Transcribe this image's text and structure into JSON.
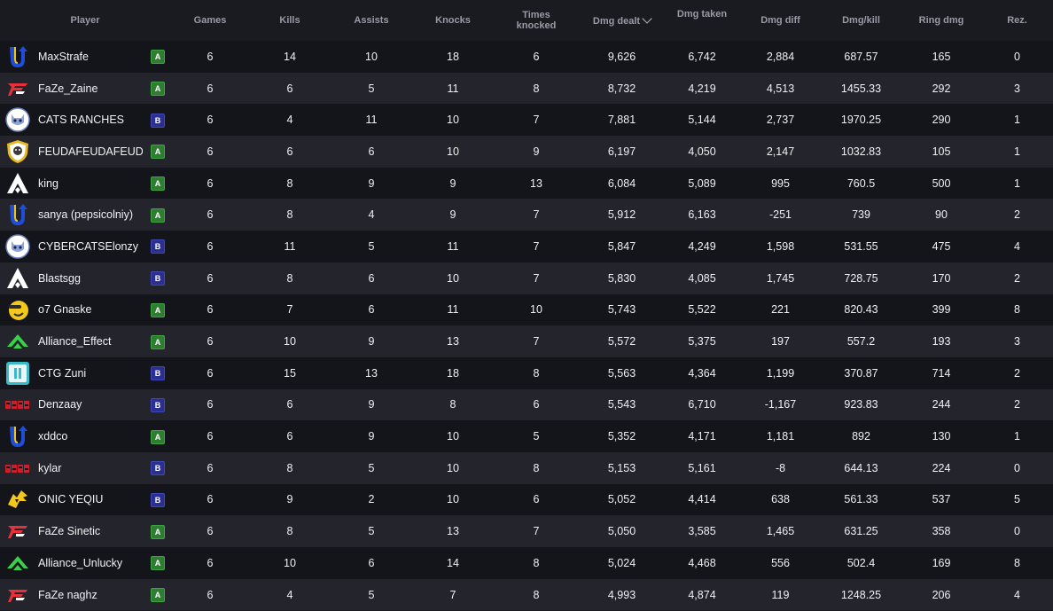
{
  "columns": [
    {
      "key": "player",
      "label": "Player"
    },
    {
      "key": "games",
      "label": "Games"
    },
    {
      "key": "kills",
      "label": "Kills"
    },
    {
      "key": "assists",
      "label": "Assists"
    },
    {
      "key": "knocks",
      "label": "Knocks"
    },
    {
      "key": "times_knocked",
      "label": "Times knocked"
    },
    {
      "key": "dmg_dealt",
      "label": "Dmg dealt",
      "sorted": "desc"
    },
    {
      "key": "dmg_taken",
      "label": "Dmg taken"
    },
    {
      "key": "dmg_diff",
      "label": "Dmg diff"
    },
    {
      "key": "dmg_kill",
      "label": "Dmg/kill"
    },
    {
      "key": "ring_dmg",
      "label": "Ring dmg"
    },
    {
      "key": "rez",
      "label": "Rez."
    }
  ],
  "colors": {
    "badge_a": "#2f7d32",
    "badge_b": "#2b2f8f",
    "row_dark": "#14141b",
    "row_light": "#24242c"
  },
  "rows": [
    {
      "logo": "u-team-logo",
      "player": "MaxStrafe",
      "group": "A",
      "games": "6",
      "kills": "14",
      "assists": "10",
      "knocks": "18",
      "times_knocked": "6",
      "dmg_dealt": "9,626",
      "dmg_taken": "6,742",
      "dmg_diff": "2,884",
      "dmg_kill": "687.57",
      "ring_dmg": "165",
      "rez": "0"
    },
    {
      "logo": "faze-logo",
      "player": "FaZe_Zaine",
      "group": "A",
      "games": "6",
      "kills": "6",
      "assists": "5",
      "knocks": "11",
      "times_knocked": "8",
      "dmg_dealt": "8,732",
      "dmg_taken": "4,219",
      "dmg_diff": "4,513",
      "dmg_kill": "1455.33",
      "ring_dmg": "292",
      "rez": "3"
    },
    {
      "logo": "cats-logo",
      "player": "CATS RANCHES",
      "group": "B",
      "games": "6",
      "kills": "4",
      "assists": "11",
      "knocks": "10",
      "times_knocked": "7",
      "dmg_dealt": "7,881",
      "dmg_taken": "5,144",
      "dmg_diff": "2,737",
      "dmg_kill": "1970.25",
      "ring_dmg": "290",
      "rez": "1"
    },
    {
      "logo": "shield-crest-logo",
      "player": "FEUDAFEUDAFEUDA",
      "group": "A",
      "games": "6",
      "kills": "6",
      "assists": "6",
      "knocks": "10",
      "times_knocked": "9",
      "dmg_dealt": "6,197",
      "dmg_taken": "4,050",
      "dmg_diff": "2,147",
      "dmg_kill": "1032.83",
      "ring_dmg": "105",
      "rez": "1"
    },
    {
      "logo": "apex-logo",
      "player": "king",
      "group": "A",
      "games": "6",
      "kills": "8",
      "assists": "9",
      "knocks": "9",
      "times_knocked": "13",
      "dmg_dealt": "6,084",
      "dmg_taken": "5,089",
      "dmg_diff": "995",
      "dmg_kill": "760.5",
      "ring_dmg": "500",
      "rez": "1"
    },
    {
      "logo": "u-team-logo",
      "player": "sanya (pepsicolniy)",
      "group": "A",
      "games": "6",
      "kills": "8",
      "assists": "4",
      "knocks": "9",
      "times_knocked": "7",
      "dmg_dealt": "5,912",
      "dmg_taken": "6,163",
      "dmg_diff": "-251",
      "dmg_kill": "739",
      "ring_dmg": "90",
      "rez": "2"
    },
    {
      "logo": "cats-logo",
      "player": "CYBERCATSElonzy",
      "group": "B",
      "games": "6",
      "kills": "11",
      "assists": "5",
      "knocks": "11",
      "times_knocked": "7",
      "dmg_dealt": "5,847",
      "dmg_taken": "4,249",
      "dmg_diff": "1,598",
      "dmg_kill": "531.55",
      "ring_dmg": "475",
      "rez": "4"
    },
    {
      "logo": "apex-logo",
      "player": "Blastsgg",
      "group": "B",
      "games": "6",
      "kills": "8",
      "assists": "6",
      "knocks": "10",
      "times_knocked": "7",
      "dmg_dealt": "5,830",
      "dmg_taken": "4,085",
      "dmg_diff": "1,745",
      "dmg_kill": "728.75",
      "ring_dmg": "170",
      "rez": "2"
    },
    {
      "logo": "smiley-logo",
      "player": "o7 Gnaske",
      "group": "A",
      "games": "6",
      "kills": "7",
      "assists": "6",
      "knocks": "11",
      "times_knocked": "10",
      "dmg_dealt": "5,743",
      "dmg_taken": "5,522",
      "dmg_diff": "221",
      "dmg_kill": "820.43",
      "ring_dmg": "399",
      "rez": "8"
    },
    {
      "logo": "alliance-logo",
      "player": "Alliance_Effect",
      "group": "A",
      "games": "6",
      "kills": "10",
      "assists": "9",
      "knocks": "13",
      "times_knocked": "7",
      "dmg_dealt": "5,572",
      "dmg_taken": "5,375",
      "dmg_diff": "197",
      "dmg_kill": "557.2",
      "ring_dmg": "193",
      "rez": "3"
    },
    {
      "logo": "ctg-logo",
      "player": "CTG Zuni",
      "group": "B",
      "games": "6",
      "kills": "15",
      "assists": "13",
      "knocks": "18",
      "times_knocked": "8",
      "dmg_dealt": "5,563",
      "dmg_taken": "4,364",
      "dmg_diff": "1,199",
      "dmg_kill": "370.87",
      "ring_dmg": "714",
      "rez": "2"
    },
    {
      "logo": "s2g-logo",
      "player": "Denzaay",
      "group": "B",
      "games": "6",
      "kills": "6",
      "assists": "9",
      "knocks": "8",
      "times_knocked": "6",
      "dmg_dealt": "5,543",
      "dmg_taken": "6,710",
      "dmg_diff": "-1,167",
      "dmg_kill": "923.83",
      "ring_dmg": "244",
      "rez": "2"
    },
    {
      "logo": "u-team-logo",
      "player": "xddco",
      "group": "A",
      "games": "6",
      "kills": "6",
      "assists": "9",
      "knocks": "10",
      "times_knocked": "5",
      "dmg_dealt": "5,352",
      "dmg_taken": "4,171",
      "dmg_diff": "1,181",
      "dmg_kill": "892",
      "ring_dmg": "130",
      "rez": "1"
    },
    {
      "logo": "s2g-logo",
      "player": "kylar",
      "group": "B",
      "games": "6",
      "kills": "8",
      "assists": "5",
      "knocks": "10",
      "times_knocked": "8",
      "dmg_dealt": "5,153",
      "dmg_taken": "5,161",
      "dmg_diff": "-8",
      "dmg_kill": "644.13",
      "ring_dmg": "224",
      "rez": "0"
    },
    {
      "logo": "onic-logo",
      "player": "ONIC YEQIU",
      "group": "B",
      "games": "6",
      "kills": "9",
      "assists": "2",
      "knocks": "10",
      "times_knocked": "6",
      "dmg_dealt": "5,052",
      "dmg_taken": "4,414",
      "dmg_diff": "638",
      "dmg_kill": "561.33",
      "ring_dmg": "537",
      "rez": "5"
    },
    {
      "logo": "faze-logo",
      "player": "FaZe Sinetic",
      "group": "A",
      "games": "6",
      "kills": "8",
      "assists": "5",
      "knocks": "13",
      "times_knocked": "7",
      "dmg_dealt": "5,050",
      "dmg_taken": "3,585",
      "dmg_diff": "1,465",
      "dmg_kill": "631.25",
      "ring_dmg": "358",
      "rez": "0"
    },
    {
      "logo": "alliance-logo",
      "player": "Alliance_Unlucky",
      "group": "A",
      "games": "6",
      "kills": "10",
      "assists": "6",
      "knocks": "14",
      "times_knocked": "8",
      "dmg_dealt": "5,024",
      "dmg_taken": "4,468",
      "dmg_diff": "556",
      "dmg_kill": "502.4",
      "ring_dmg": "169",
      "rez": "8"
    },
    {
      "logo": "faze-logo",
      "player": "FaZe naghz",
      "group": "A",
      "games": "6",
      "kills": "4",
      "assists": "5",
      "knocks": "7",
      "times_knocked": "8",
      "dmg_dealt": "4,993",
      "dmg_taken": "4,874",
      "dmg_diff": "119",
      "dmg_kill": "1248.25",
      "ring_dmg": "206",
      "rez": "4"
    }
  ]
}
